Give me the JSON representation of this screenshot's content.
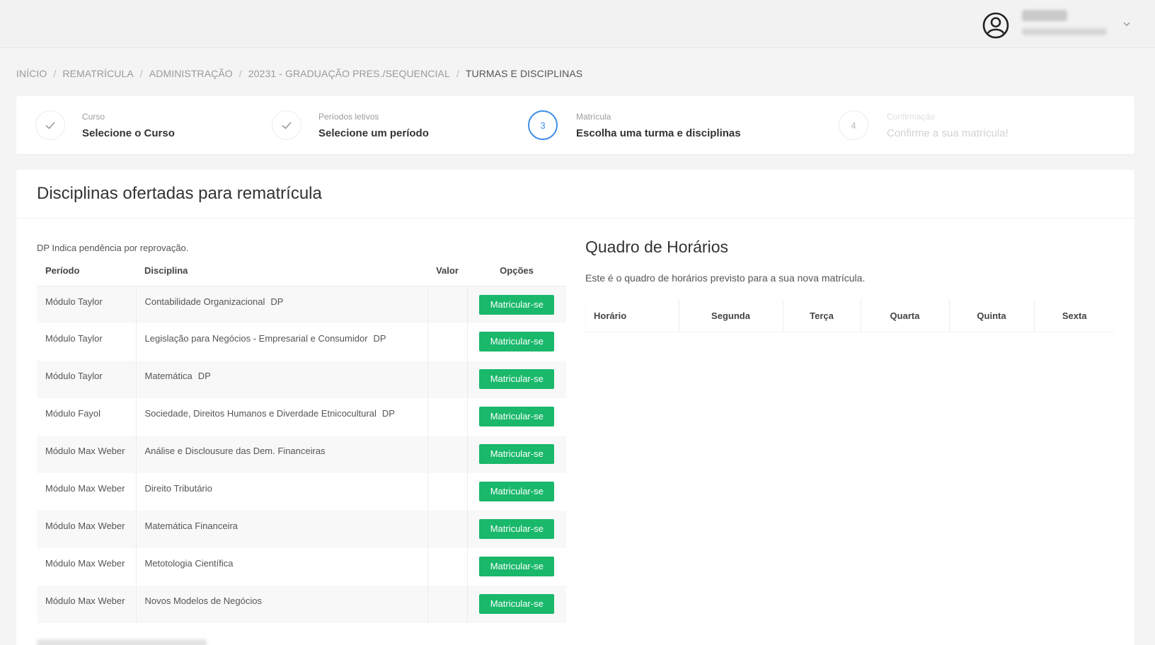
{
  "breadcrumb": [
    "INÍCIO",
    "REMATRÍCULA",
    "ADMINISTRAÇÃO",
    "20231 - GRADUAÇÃO PRES./SEQUENCIAL",
    "TURMAS E DISCIPLINAS"
  ],
  "stepper": [
    {
      "num": "",
      "small": "Curso",
      "big": "Selecione o Curso",
      "state": "done"
    },
    {
      "num": "",
      "small": "Períodos letivos",
      "big": "Selecione um período",
      "state": "done"
    },
    {
      "num": "3",
      "small": "Matrícula",
      "big": "Escolha uma turma e disciplinas",
      "state": "active"
    },
    {
      "num": "4",
      "small": "Confirmação",
      "big": "Confirme a sua matrícula!",
      "state": "disabled"
    }
  ],
  "offer": {
    "title": "Disciplinas ofertadas para rematrícula",
    "note": "DP Indica pendência por reprovação.",
    "headers": {
      "periodo": "Período",
      "disciplina": "Disciplina",
      "valor": "Valor",
      "opcoes": "Opções"
    },
    "button_label": "Matricular-se",
    "rows": [
      {
        "periodo": "Módulo Taylor",
        "disciplina": "Contabilidade Organizacional",
        "dp": "DP",
        "valor": ""
      },
      {
        "periodo": "Módulo Taylor",
        "disciplina": "Legislação para Negócios - Empresarial e Consumidor",
        "dp": "DP",
        "valor": ""
      },
      {
        "periodo": "Módulo Taylor",
        "disciplina": "Matemática",
        "dp": "DP",
        "valor": ""
      },
      {
        "periodo": "Módulo Fayol",
        "disciplina": "Sociedade, Direitos Humanos e Diverdade Etnicocultural",
        "dp": "DP",
        "valor": ""
      },
      {
        "periodo": "Módulo Max Weber",
        "disciplina": "Análise e Disclousure das Dem. Financeiras",
        "dp": "",
        "valor": ""
      },
      {
        "periodo": "Módulo Max Weber",
        "disciplina": "Direito Tributário",
        "dp": "",
        "valor": ""
      },
      {
        "periodo": "Módulo Max Weber",
        "disciplina": "Matemática Financeira",
        "dp": "",
        "valor": ""
      },
      {
        "periodo": "Módulo Max Weber",
        "disciplina": "Metotologia Científica",
        "dp": "",
        "valor": ""
      },
      {
        "periodo": "Módulo Max Weber",
        "disciplina": "Novos Modelos de Negócios",
        "dp": "",
        "valor": ""
      }
    ]
  },
  "schedule": {
    "title": "Quadro de Horários",
    "description": "Este é o quadro de horários previsto para a sua nova matrícula.",
    "headers": [
      "Horário",
      "Segunda",
      "Terça",
      "Quarta",
      "Quinta",
      "Sexta"
    ]
  },
  "icons": {
    "user": "user-circle-icon",
    "chevron": "chevron-down-icon",
    "check": "check-icon"
  },
  "colors": {
    "accent": "#3d8fe8",
    "button": "#19b86a"
  }
}
